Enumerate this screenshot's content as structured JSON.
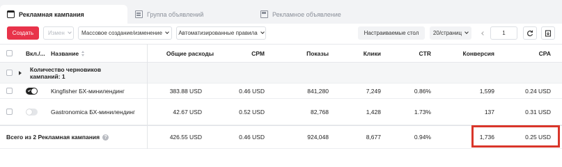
{
  "tabs": [
    {
      "label": "Рекламная кампания",
      "icon": "folder-icon",
      "active": true
    },
    {
      "label": "Группа объявлений",
      "icon": "grid-icon",
      "active": false
    },
    {
      "label": "Рекламное объявление",
      "icon": "doc-icon",
      "active": false
    }
  ],
  "toolbar": {
    "create": "Создать",
    "edit": "Измен",
    "bulk": "Массовое создание/изменение",
    "auto_rules": "Автоматизированные правила",
    "custom_cols": "Настраиваемые стол",
    "per_page": "20/страниц",
    "page": "1"
  },
  "columns": {
    "on_off": "Вкл./...",
    "name": "Название",
    "spend": "Общие расходы",
    "cpm": "CPM",
    "impressions": "Показы",
    "clicks": "Клики",
    "ctr": "CTR",
    "conversions": "Конверсия",
    "cpa": "CPA"
  },
  "drafts": {
    "label": "Количество черновиков кампаний: 1"
  },
  "rows": [
    {
      "toggle": "on",
      "name": "Kingfisher БХ-минилендинг",
      "spend": "383.88 USD",
      "cpm": "0.46 USD",
      "impressions": "841,280",
      "clicks": "7,249",
      "ctr": "0.86%",
      "conversions": "1,599",
      "cpa": "0.24 USD"
    },
    {
      "toggle": "off",
      "name": "Gastronomica БХ-минилендинг",
      "spend": "42.67 USD",
      "cpm": "0.52 USD",
      "impressions": "82,768",
      "clicks": "1,428",
      "ctr": "1.73%",
      "conversions": "137",
      "cpa": "0.31 USD"
    }
  ],
  "total": {
    "label": "Всего из 2 Рекламная кампания",
    "spend": "426.55 USD",
    "cpm": "0.46 USD",
    "impressions": "924,048",
    "clicks": "8,677",
    "ctr": "0.94%",
    "conversions": "1,736",
    "cpa": "0.25 USD"
  },
  "colors": {
    "accent": "#e8334a",
    "highlight": "#d9362a"
  }
}
